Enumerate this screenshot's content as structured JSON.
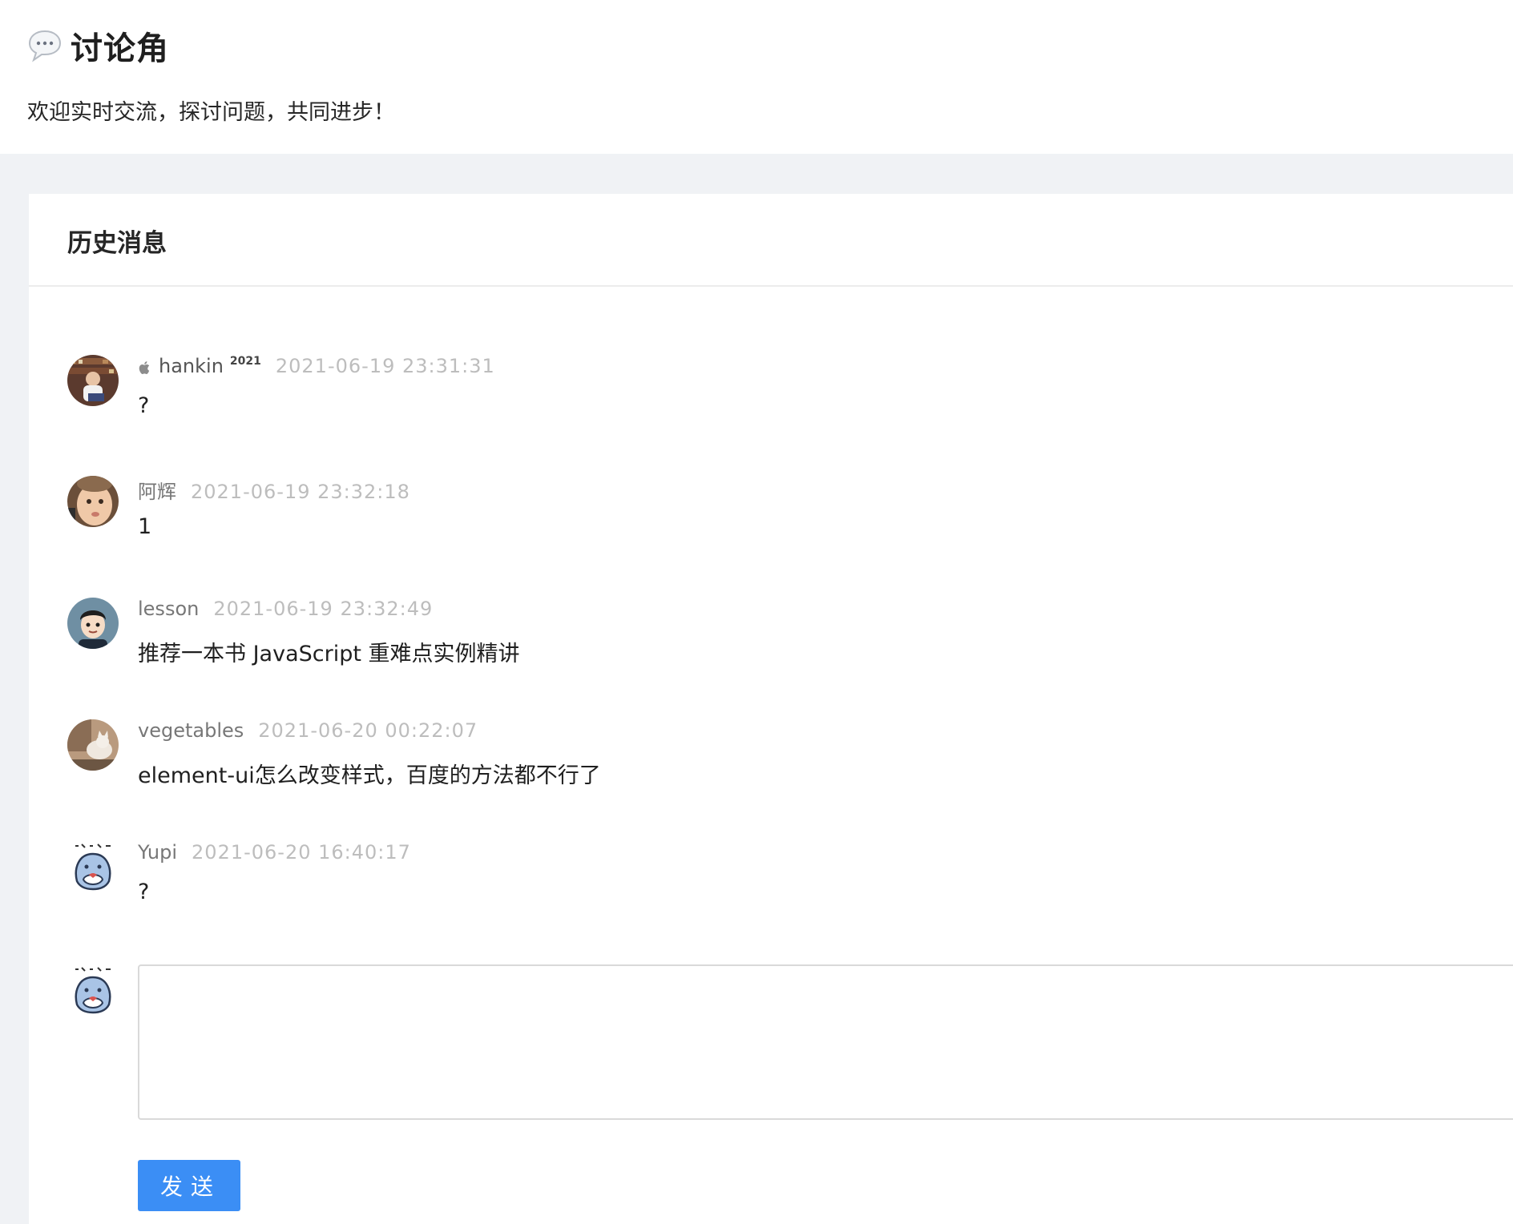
{
  "header": {
    "icon": "speech-bubble-icon",
    "title": "讨论角",
    "subtitle": "欢迎实时交流，探讨问题，共同进步！"
  },
  "history": {
    "title": "历史消息",
    "messages": [
      {
        "author": "hankin",
        "tag": "2021",
        "platform_icon": "apple-icon",
        "time": "2021-06-19 23:31:31",
        "content": "?"
      },
      {
        "author": "阿辉",
        "time": "2021-06-19 23:32:18",
        "content": "1"
      },
      {
        "author": "lesson",
        "time": "2021-06-19 23:32:49",
        "content": "推荐一本书 JavaScript 重难点实例精讲"
      },
      {
        "author": "vegetables",
        "time": "2021-06-20 00:22:07",
        "content": "element-ui怎么改变样式，百度的方法都不行了"
      },
      {
        "author": "Yupi",
        "time": "2021-06-20 16:40:17",
        "content": "?"
      }
    ]
  },
  "composer": {
    "value": "",
    "send_label": "发送"
  },
  "colors": {
    "primary": "#3b8ef5",
    "background": "#f0f2f5",
    "timestamp": "#bdbdbd"
  }
}
